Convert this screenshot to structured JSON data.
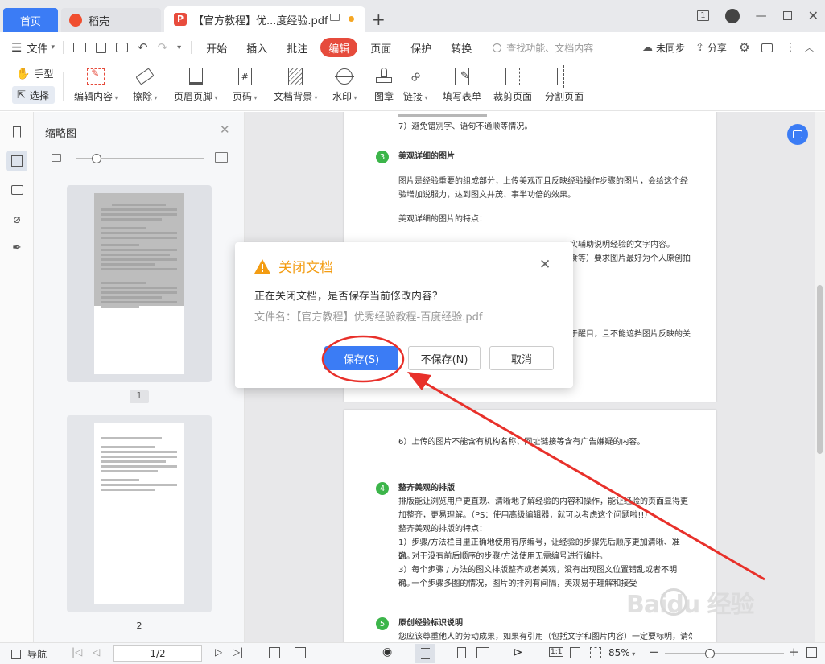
{
  "tabs": {
    "home": "首页",
    "wps": "稻壳",
    "doc": "【官方教程】优...度经验.pdf"
  },
  "menu": {
    "file": "文件",
    "items": [
      "开始",
      "插入",
      "批注",
      "编辑",
      "页面",
      "保护",
      "转换"
    ],
    "active_item": "编辑",
    "search_placeholder": "查找功能、文档内容",
    "sync": "未同步",
    "share": "分享"
  },
  "toolbar": {
    "hand": "手型",
    "select": "选择",
    "tools": [
      "编辑内容",
      "擦除",
      "页眉页脚",
      "页码",
      "文档背景",
      "水印",
      "图章",
      "链接",
      "填写表单",
      "裁剪页面",
      "分割页面"
    ]
  },
  "thumbnail_panel": {
    "title": "缩略图",
    "page1_label": "1",
    "page2_label": "2"
  },
  "document": {
    "page1": {
      "top_line": "7）避免错别字、语句不通顺等情况。",
      "step3_num": "3",
      "step3_title": "美观详细的图片",
      "p1": "图片是经验重要的组成部分，上传美观而且反映经验操作步骤的图片，会给这个经验增加说服力，达到图文并茂、事半功倍的效果。",
      "p2": "美观详细的图片的特点：",
      "frag1": "实辅助说明经验的文字内容。",
      "frag2": "食等）要求图片最好为个人原创拍",
      "frag3": "于醒目，且不能遮挡图片反映的关"
    },
    "page2": {
      "line6": "6）上传的图片不能含有机构名称、网址链接等含有广告嫌疑的内容。",
      "step4_num": "4",
      "step4_title": "整齐美观的排版",
      "p1": "排版能让浏览用户更直观、清晰地了解经验的内容和操作，能让经验的页面显得更加整齐，更易理解。（PS：使用高级编辑器，就可以考虑这个问题啦!!）",
      "p2": "整齐美观的排版的特点：",
      "items": [
        "1）步骤/方法栏目里正确地使用有序编号，让经验的步骤先后顺序更加清晰、准确。",
        "2）对于没有前后顺序的步骤/方法使用无需编号进行编排。",
        "3）每个步骤 / 方法的图文排版整齐或者美观，没有出现图文位置错乱或者不明确。",
        "4）一个步骤多图的情况，图片的排列有间隔，美观易于理解和接受"
      ],
      "step5_num": "5",
      "step5_title": "原创经验标识说明",
      "p3": "您应该尊重他人的劳动成果，如果有引用（包括文字和图片内容）一定要标明，请勿抄"
    }
  },
  "dialog": {
    "title": "关闭文档",
    "message": "正在关闭文档，是否保存当前修改内容？",
    "filename": "文件名：【官方教程】优秀经验教程-百度经验.pdf",
    "save": "保存(S)",
    "nosave": "不保存(N)",
    "cancel": "取消"
  },
  "statusbar": {
    "nav": "导航",
    "page": "1/2",
    "zoom": "85%"
  },
  "watermark": "Baidu 经验",
  "colors": {
    "accent_blue": "#3b7cf5",
    "active_red": "#e64b3c",
    "step_green": "#3cb54a",
    "warning_orange": "#f39c12",
    "annotation_red": "#e8302a"
  }
}
